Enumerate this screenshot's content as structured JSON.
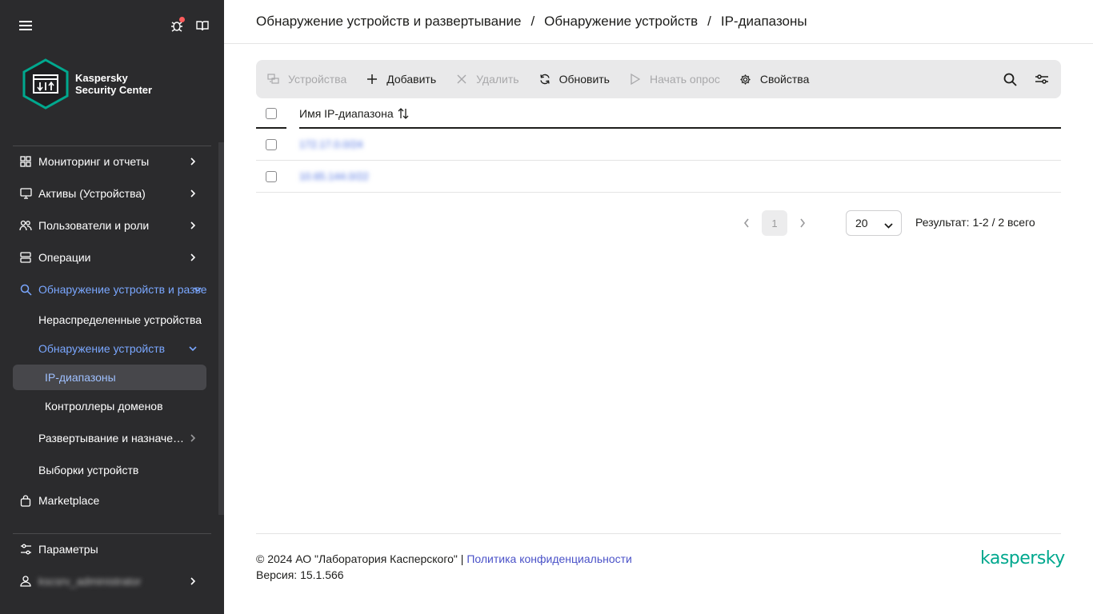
{
  "sidebar": {
    "logo": {
      "line1": "Kaspersky",
      "line2": "Security Center"
    },
    "nav": [
      {
        "label": "Мониторинг и отчеты"
      },
      {
        "label": "Активы (Устройства)"
      },
      {
        "label": "Пользователи и роли"
      },
      {
        "label": "Операции"
      },
      {
        "label": "Обнаружение устройств и развертывание"
      },
      {
        "label": "Нераспределенные устройства"
      },
      {
        "label": "Обнаружение устройств"
      },
      {
        "label": "IP-диапазоны"
      },
      {
        "label": "Контроллеры доменов"
      },
      {
        "label": "Развертывание и назначение"
      },
      {
        "label": "Выборки устройств"
      },
      {
        "label": "Marketplace"
      }
    ],
    "bottom": [
      {
        "label": "Параметры"
      },
      {
        "label": "kscsrv_administrator"
      }
    ]
  },
  "breadcrumb": {
    "items": [
      "Обнаружение устройств и развертывание",
      "Обнаружение устройств",
      "IP-диапазоны"
    ],
    "separator": "/"
  },
  "toolbar": {
    "devices": "Устройства",
    "add": "Добавить",
    "delete": "Удалить",
    "refresh": "Обновить",
    "start_poll": "Начать опрос",
    "properties": "Свойства"
  },
  "table": {
    "column": "Имя IP-диапазона",
    "rows": [
      "172.17.0.0/24",
      "10.65.144.0/22"
    ]
  },
  "pagination": {
    "current_page": "1",
    "page_size": "20",
    "result": "Результат: 1-2 / 2 всего"
  },
  "footer": {
    "copyright": "© 2024 АО \"Лаборатория Касперского\" |",
    "privacy": "Политика конфиденциальности",
    "version": "Версия: 15.1.566",
    "brand": "kaspersky"
  },
  "colors": {
    "sidebar_bg": "#2b2b2d",
    "accent": "#7aa7ff",
    "brand": "#00a88e",
    "link": "#4a52c8"
  }
}
